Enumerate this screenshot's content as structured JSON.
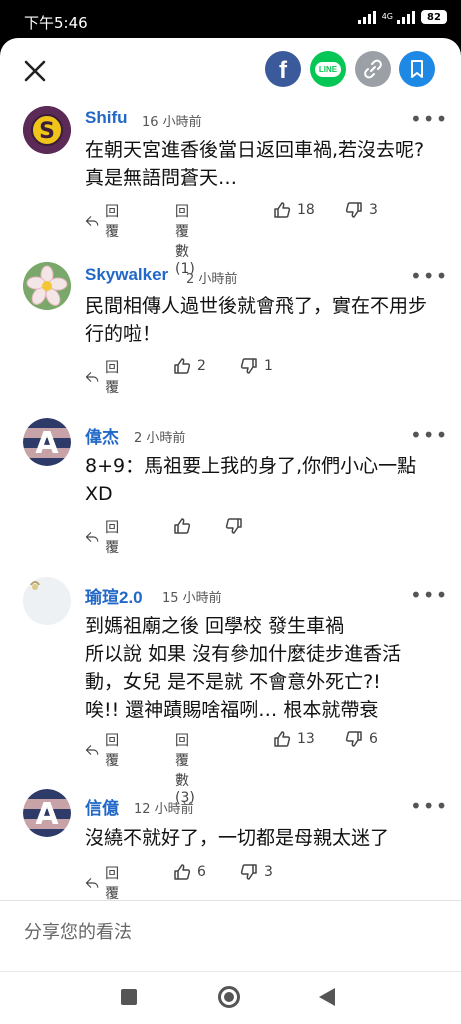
{
  "status": {
    "time": "下午5:46",
    "network": "4G",
    "battery": "82"
  },
  "comments": [
    {
      "user": "Shifu",
      "time": "16 小時前",
      "text": "在朝天宮進香後當日返回車禍,若沒去呢?真是無語問蒼天…",
      "reply": "回覆",
      "replies": "回覆數 (1)",
      "likes": "18",
      "dislikes": "3"
    },
    {
      "user": "Skywalker",
      "time": "2 小時前",
      "text": "民間相傳人過世後就會飛了，實在不用步行的啦！",
      "reply": "回覆",
      "likes": "2",
      "dislikes": "1"
    },
    {
      "user": "偉杰",
      "time": "2 小時前",
      "text": "8+9：馬祖要上我的身了,你們小心一點XD",
      "reply": "回覆",
      "likes": "",
      "dislikes": ""
    },
    {
      "user": "瑜瑄2.0",
      "time": "15 小時前",
      "text": "到媽祖廟之後 回學校 發生車禍\n所以說 如果 沒有參加什麼徒步進香活動，女兒 是不是就 不會意外死亡?!\n唉!! 還神蹟賜啥福咧… 根本就帶衰",
      "reply": "回覆",
      "replies": "回覆數 (3)",
      "likes": "13",
      "dislikes": "6"
    },
    {
      "user": "信億",
      "time": "12 小時前",
      "text": "沒繞不就好了，一切都是母親太迷了",
      "reply": "回覆",
      "likes": "6",
      "dislikes": "3"
    }
  ],
  "input_placeholder": "分享您的看法",
  "colors": {
    "name": "#2268c8",
    "facebook": "#3a5a9b",
    "line": "#06c755",
    "link": "#9aa0a6",
    "bookmark": "#1e88e5"
  }
}
